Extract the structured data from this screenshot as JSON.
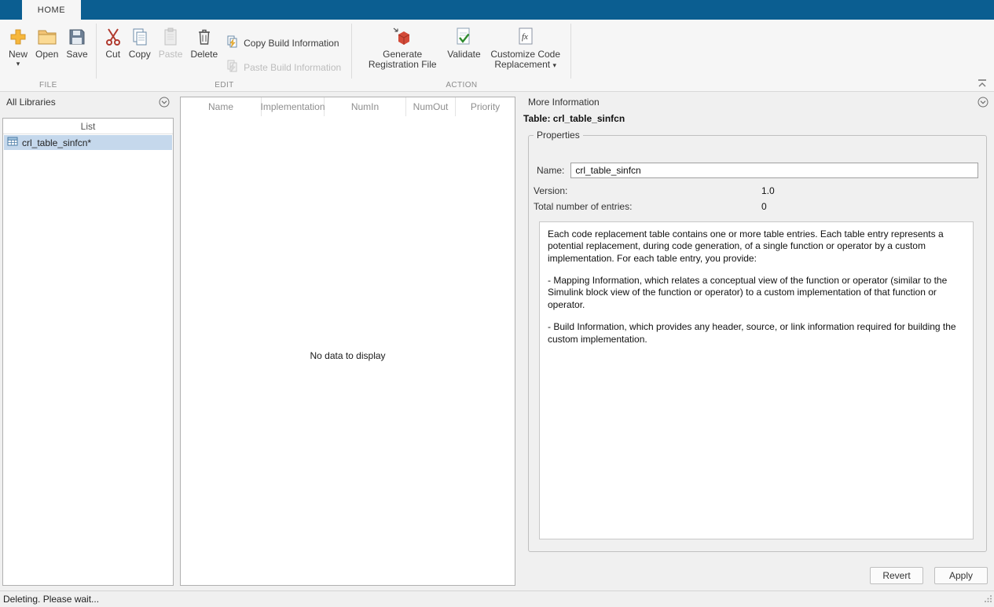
{
  "icons": {
    "dropdown_arrow": "▾",
    "fx": "fx"
  },
  "titlebar": {
    "home_tab": "HOME"
  },
  "ribbon": {
    "file": {
      "group_label": "FILE",
      "new": "New",
      "open": "Open",
      "save": "Save"
    },
    "edit": {
      "group_label": "EDIT",
      "cut": "Cut",
      "copy": "Copy",
      "paste": "Paste",
      "delete": "Delete",
      "copy_build_info": "Copy Build Information",
      "paste_build_info": "Paste Build Information"
    },
    "action": {
      "group_label": "ACTION",
      "generate_registration_file": "Generate Registration File",
      "validate": "Validate",
      "customize_code_replacement": "Customize Code Replacement"
    }
  },
  "left_panel": {
    "title": "All Libraries",
    "list_header": "List",
    "items": [
      {
        "label": "crl_table_sinfcn*",
        "selected": true
      }
    ]
  },
  "center_panel": {
    "columns": [
      "Name",
      "Implementation",
      "NumIn",
      "NumOut",
      "Priority"
    ],
    "empty_message": "No data to display"
  },
  "right_panel": {
    "title": "More Information",
    "table_heading": "Table: crl_table_sinfcn",
    "properties": {
      "legend": "Properties",
      "name_label": "Name:",
      "name_value": "crl_table_sinfcn",
      "version_label": "Version:",
      "version_value": "1.0",
      "entries_label": "Total number of entries:",
      "entries_value": "0",
      "desc_p1": "Each code replacement table contains one or more table entries. Each table entry represents a potential replacement, during code generation, of a single function or operator by a custom implementation. For each table entry, you provide:",
      "desc_p2": "- Mapping Information, which relates a conceptual view of the function or operator (similar to the Simulink block view of the function or operator) to a custom implementation of that function or operator.",
      "desc_p3": "- Build Information, which provides any header, source, or link information required for building the custom implementation."
    },
    "revert_button": "Revert",
    "apply_button": "Apply"
  },
  "statusbar": {
    "text": "Deleting. Please wait..."
  }
}
